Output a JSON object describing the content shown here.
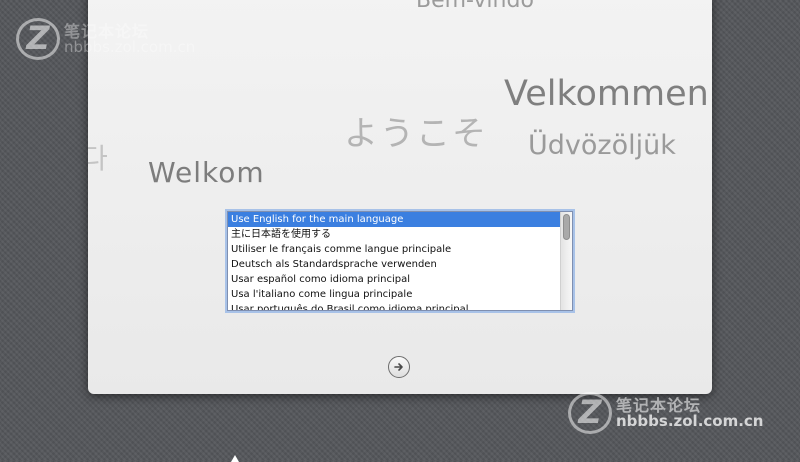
{
  "welcome_words": {
    "bem_vindo": "Bem-vindo",
    "velkommen": "Velkommen",
    "youkoso": "ようこそ",
    "udvozoljuk": "Üdvözöljük",
    "hangul_fragment": "다",
    "welkom": "Welkom"
  },
  "language_list": {
    "items": [
      "Use English for the main language",
      "主に日本語を使用する",
      "Utiliser le français comme langue principale",
      "Deutsch als Standardsprache verwenden",
      "Usar español como idioma principal",
      "Usa l'italiano come lingua principale",
      "Usar português do Brasil como idioma principal"
    ],
    "selected_index": 0,
    "selected_color": "#3b7fe0"
  },
  "continue_button": {
    "icon": "arrow-right-circle-icon"
  },
  "watermarks": {
    "top": {
      "logo": "Z",
      "cn": "笔记本论坛",
      "url": "nbbbs.zol.com.cn"
    },
    "bottom": {
      "logo": "Z",
      "cn": "笔记本论坛",
      "url": "nbbbs.zol.com.cn"
    }
  },
  "colors": {
    "background": "#55575b",
    "panel": "#efefef",
    "selection": "#3b7fe0"
  }
}
